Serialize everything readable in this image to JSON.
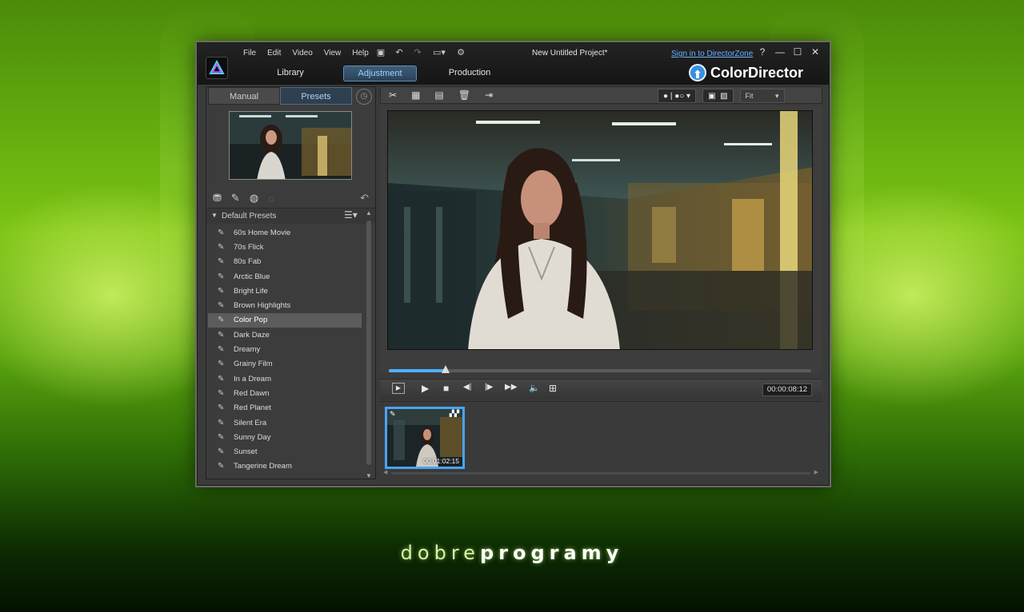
{
  "watermark": {
    "light": "dobre",
    "bold": "programy"
  },
  "window": {
    "menu": [
      "File",
      "Edit",
      "Video",
      "View",
      "Help"
    ],
    "quick_tools": [
      {
        "name": "save-icon",
        "glyph": "▣"
      },
      {
        "name": "undo-icon",
        "glyph": "↶"
      },
      {
        "name": "redo-icon",
        "glyph": "↷"
      },
      {
        "name": "display-icon",
        "glyph": "▭▾"
      },
      {
        "name": "settings-icon",
        "glyph": "⚙"
      }
    ],
    "project_title": "New Untitled Project*",
    "sign_in": "Sign in to DirectorZone",
    "controls": {
      "help": "?",
      "minimize": "—",
      "maximize": "☐",
      "close": "✕"
    },
    "modes": [
      "Library",
      "Adjustment",
      "Production"
    ],
    "active_mode": "Adjustment",
    "product_name": "ColorDirector",
    "product_icon": "⬆"
  },
  "left_panel": {
    "tabs": [
      "Manual",
      "Presets"
    ],
    "active_tab": "Presets",
    "history_icon": "◷",
    "preset_tools": [
      {
        "name": "import-preset-icon",
        "glyph": "⛃"
      },
      {
        "name": "add-preset-icon",
        "glyph": "✎"
      },
      {
        "name": "download-preset-icon",
        "glyph": "◍"
      },
      {
        "name": "upload-preset-icon",
        "glyph": "◌"
      }
    ],
    "undo_icon": "↶",
    "list_header": "Default Presets",
    "list_menu_icon": "☰▾",
    "presets": [
      "60s Home Movie",
      "70s Flick",
      "80s Fab",
      "Arctic Blue",
      "Bright Life",
      "Brown Highlights",
      "Color Pop",
      "Dark Daze",
      "Dreamy",
      "Grainy Film",
      "In a Dream",
      "Red Dawn",
      "Red Planet",
      "Silent Era",
      "Sunny Day",
      "Sunset",
      "Tangerine Dream"
    ],
    "selected_preset": "Color Pop"
  },
  "toolbar": {
    "tools": [
      {
        "name": "cut-icon",
        "glyph": "✂"
      },
      {
        "name": "split-icon",
        "glyph": "▦"
      },
      {
        "name": "merge-icon",
        "glyph": "▤"
      },
      {
        "name": "delete-icon",
        "glyph": "🗑"
      },
      {
        "name": "export-icon",
        "glyph": "⇥"
      }
    ],
    "compare": "● | ●○ ▾",
    "fit": "Fit",
    "fit_arrow": "▾"
  },
  "player": {
    "progress": 0.135,
    "timecode": "00:00:08:12",
    "buttons": [
      {
        "name": "preview-mode-icon",
        "glyph": "▶"
      },
      {
        "name": "play-icon",
        "glyph": "▶"
      },
      {
        "name": "stop-icon",
        "glyph": "■"
      },
      {
        "name": "previous-frame-icon",
        "glyph": "◀|"
      },
      {
        "name": "next-frame-icon",
        "glyph": "|▶"
      },
      {
        "name": "fast-forward-icon",
        "glyph": "▶▶"
      },
      {
        "name": "volume-icon",
        "glyph": "🔈"
      },
      {
        "name": "snapshot-icon",
        "glyph": "⊞"
      }
    ]
  },
  "filmstrip": {
    "clip_timecode": "00:01:02:15"
  },
  "colors": {
    "accent": "#4aa3f0",
    "panel": "#3a3a3a",
    "link": "#6ab0ff"
  }
}
